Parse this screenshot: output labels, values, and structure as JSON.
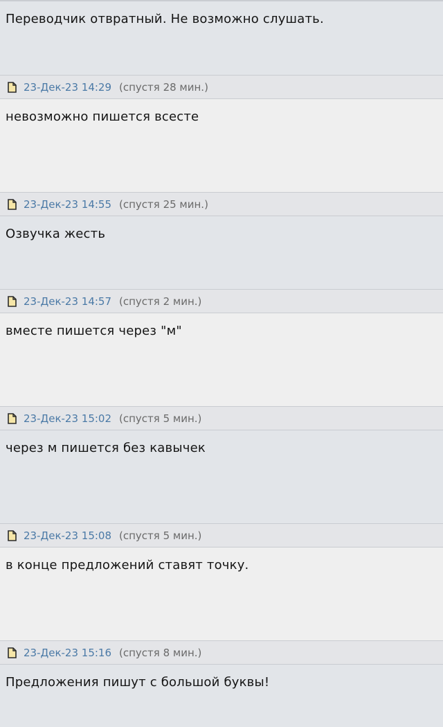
{
  "posts": [
    {
      "date": "",
      "since": "",
      "text": "Переводчик отвратный. Не возможно слушать."
    },
    {
      "date": "23-Дек-23 14:29",
      "since": "(спустя 28 мин.)",
      "text": "невозможно пишется всесте"
    },
    {
      "date": "23-Дек-23 14:55",
      "since": "(спустя 25 мин.)",
      "text": "Озвучка жесть"
    },
    {
      "date": "23-Дек-23 14:57",
      "since": "(спустя 2 мин.)",
      "text": "вместе пишется через \"м\""
    },
    {
      "date": "23-Дек-23 15:02",
      "since": "(спустя 5 мин.)",
      "text": "через м пишется без кавычек"
    },
    {
      "date": "23-Дек-23 15:08",
      "since": "(спустя 5 мин.)",
      "text": "в конце предложений ставят точку."
    },
    {
      "date": "23-Дек-23 15:16",
      "since": "(спустя 8 мин.)",
      "text": "Предложения пишут с большой буквы!"
    }
  ],
  "icons": {
    "post_link": "document-icon"
  },
  "colors": {
    "date_link": "#4a79a6",
    "header_bg": "#e4e5e8",
    "body_alt_bg": "#e2e5e9",
    "body_bg": "#efefef"
  }
}
